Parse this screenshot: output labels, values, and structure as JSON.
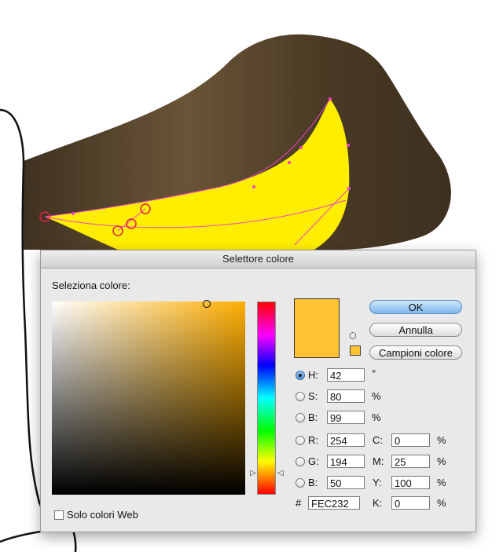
{
  "dialog": {
    "title": "Selettore colore",
    "select_label": "Seleziona colore:",
    "web_only_label": "Solo colori Web",
    "buttons": {
      "ok": "OK",
      "cancel": "Annulla",
      "swatches": "Campioni colore"
    }
  },
  "colors": {
    "current": "#FEC232",
    "hue_pure": "#FEAE00",
    "dialog_bg": "#e9e9e9"
  },
  "hsb": {
    "h": {
      "label": "H:",
      "value": "42",
      "unit": "°",
      "selected": true
    },
    "s": {
      "label": "S:",
      "value": "80",
      "unit": "%"
    },
    "b": {
      "label": "B:",
      "value": "99",
      "unit": "%"
    }
  },
  "rgb": {
    "r": {
      "label": "R:",
      "value": "254"
    },
    "g": {
      "label": "G:",
      "value": "194"
    },
    "b": {
      "label": "B:",
      "value": "50"
    }
  },
  "cmyk": {
    "c": {
      "label": "C:",
      "value": "0",
      "unit": "%"
    },
    "m": {
      "label": "M:",
      "value": "25",
      "unit": "%"
    },
    "y": {
      "label": "Y:",
      "value": "100",
      "unit": "%"
    },
    "k": {
      "label": "K:",
      "value": "0",
      "unit": "%"
    }
  },
  "hex": {
    "label": "#",
    "value": "FEC232"
  },
  "icons": {
    "cube": "gamut-cube-icon",
    "radio": "radio-icon"
  }
}
